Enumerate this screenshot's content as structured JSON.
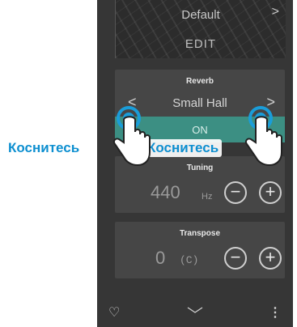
{
  "header": {
    "preset": "Default",
    "edit_label": "EDIT"
  },
  "reverb": {
    "label": "Reverb",
    "value": "Small Hall",
    "toggle": "ON"
  },
  "tuning": {
    "label": "Tuning",
    "value": "440",
    "unit": "Hz"
  },
  "transpose": {
    "label": "Transpose",
    "value": "0",
    "key": "(C)"
  },
  "annotations": {
    "tap_left": "Коснитесь",
    "tap_right": "Коснитесь"
  },
  "icons": {
    "prev": "chevron-left-icon",
    "next": "chevron-right-icon",
    "minus": "minus-icon",
    "plus": "plus-icon",
    "favorite": "heart-icon",
    "collapse": "chevron-down-icon",
    "menu": "more-vertical-icon",
    "hand": "tapping-hand-icon"
  },
  "colors": {
    "panel_bg": "#363636",
    "card_bg": "#464646",
    "toggle_on": "#3c8f83",
    "annotation": "#0d8fd0",
    "touch_ring": "#1a9dd9"
  }
}
